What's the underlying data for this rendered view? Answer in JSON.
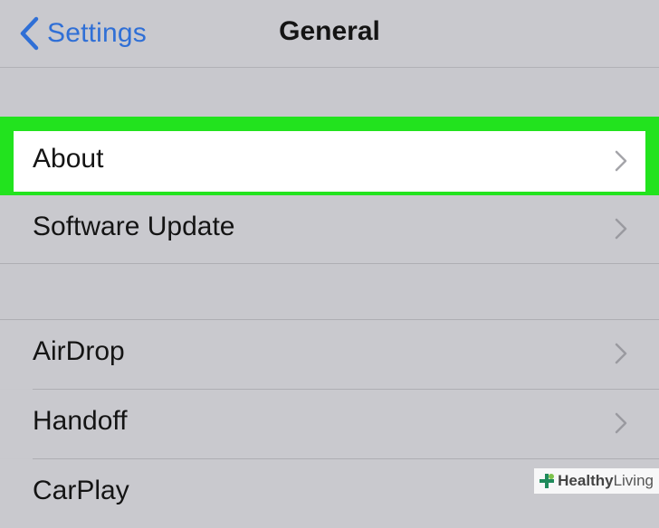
{
  "nav": {
    "back_label": "Settings",
    "title": "General"
  },
  "rows": {
    "about": "About",
    "software_update": "Software Update",
    "airdrop": "AirDrop",
    "handoff": "Handoff",
    "carplay": "CarPlay"
  },
  "highlight": {
    "color": "#22e31e"
  },
  "watermark": {
    "brand": "Healthy",
    "brand_suffix": "Living"
  },
  "colors": {
    "link": "#2f6fd6",
    "background": "#c9c9ce",
    "chevron": "#9a9aa0"
  }
}
